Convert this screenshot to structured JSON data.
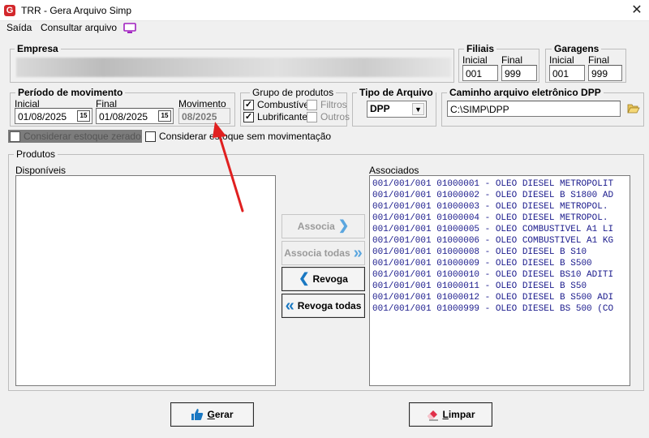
{
  "window": {
    "title": "TRR - Gera Arquivo Simp",
    "app_icon_letter": "G",
    "close_glyph": "✕"
  },
  "menu": {
    "items": [
      "Saída",
      "Consultar arquivo"
    ],
    "monitor_icon": "monitor-icon"
  },
  "empresa": {
    "legend": "Empresa"
  },
  "filiais": {
    "legend": "Filiais",
    "inicial_label": "Inicial",
    "final_label": "Final",
    "inicial_value": "001",
    "final_value": "999"
  },
  "garagens": {
    "legend": "Garagens",
    "inicial_label": "Inicial",
    "final_label": "Final",
    "inicial_value": "001",
    "final_value": "999"
  },
  "periodo": {
    "legend": "Período de movimento",
    "inicial_label": "Inicial",
    "final_label": "Final",
    "movimento_label": "Movimento",
    "inicial_value": "01/08/2025",
    "final_value": "01/08/2025",
    "movimento_value": "08/2025",
    "calendar_glyph": "15"
  },
  "grupo": {
    "legend": "Grupo de produtos",
    "combustivel_label": "Combustível",
    "combustivel_checked": true,
    "lubrificante_label": "Lubrificante",
    "lubrificante_checked": true,
    "filtros_label": "Filtros",
    "filtros_checked": false,
    "outros_label": "Outros",
    "outros_checked": false,
    "check_glyph": "✓"
  },
  "tipo_arquivo": {
    "legend": "Tipo de Arquivo",
    "value": "DPP",
    "arrow_glyph": "▼"
  },
  "caminho": {
    "legend": "Caminho arquivo eletrônico DPP",
    "value": "C:\\SIMP\\DPP",
    "folder_glyph": "📂"
  },
  "options": {
    "estoque_zerado_label": "Considerar estoque zerado",
    "sem_movimentacao_label": "Considerar estoque sem movimentação"
  },
  "produtos": {
    "legend": "Produtos",
    "disponiveis_label": "Disponíveis",
    "associados_label": "Associados",
    "associados": [
      "001/001/001 01000001 - OLEO DIESEL METROPOLIT",
      "001/001/001 01000002 - OLEO DIESEL B S1800 AD",
      "001/001/001 01000003 - OLEO DIESEL METROPOL. ",
      "001/001/001 01000004 - OLEO DIESEL METROPOL. ",
      "001/001/001 01000005 - OLEO COMBUSTIVEL A1 LI",
      "001/001/001 01000006 - OLEO COMBUSTIVEL A1 KG",
      "001/001/001 01000008 - OLEO DIESEL B S10",
      "001/001/001 01000009 - OLEO DIESEL B S500",
      "001/001/001 01000010 - OLEO DIESEL BS10 ADITI",
      "001/001/001 01000011 - OLEO DIESEL B S50",
      "001/001/001 01000012 - OLEO DIESEL B S500 ADI",
      "001/001/001 01000999 - OLEO DIESEL BS 500 (CO"
    ]
  },
  "buttons": {
    "associa": "Associa",
    "associa_todas": "Associa todas",
    "revoga": "Revoga",
    "revoga_todas": "Revoga todas",
    "gerar": "Gerar",
    "limpar": "Limpar",
    "single_chev_right": "❯",
    "double_chev_right": "»",
    "single_chev_left": "❮",
    "double_chev_left": "«"
  },
  "colors": {
    "list_text": "#1a1a8c",
    "accent_blue": "#1a78c2",
    "annotation_arrow": "#e02020",
    "app_icon": "#d3282c"
  }
}
